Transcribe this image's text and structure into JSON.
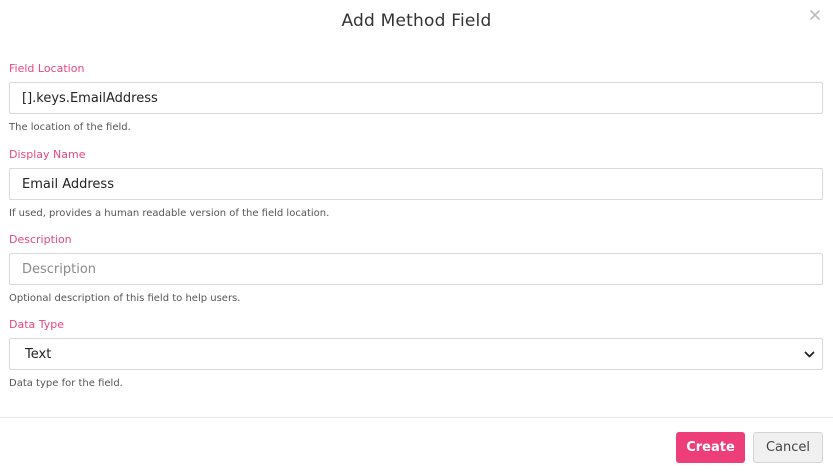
{
  "modal": {
    "title": "Add Method Field",
    "close_icon": "close-icon"
  },
  "fields": {
    "field_location": {
      "label": "Field Location",
      "value": "[].keys.EmailAddress",
      "help": "The location of the field."
    },
    "display_name": {
      "label": "Display Name",
      "value": "Email Address",
      "help": "If used, provides a human readable version of the field location."
    },
    "description": {
      "label": "Description",
      "value": "",
      "placeholder": "Description",
      "help": "Optional description of this field to help users."
    },
    "data_type": {
      "label": "Data Type",
      "selected": "Text",
      "help": "Data type for the field."
    }
  },
  "footer": {
    "create_label": "Create",
    "cancel_label": "Cancel"
  },
  "colors": {
    "accent": "#ee3e7a",
    "label": "#e9477f"
  }
}
